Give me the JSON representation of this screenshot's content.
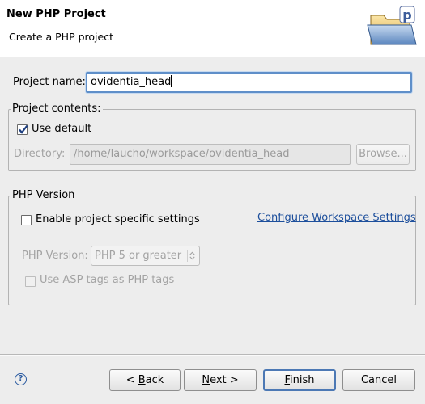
{
  "header": {
    "title": "New PHP Project",
    "description": "Create a PHP project",
    "icon": "php-project-folder-icon"
  },
  "project_name": {
    "label": "Project name:",
    "value": "ovidentia_head"
  },
  "contents": {
    "legend": "Project contents:",
    "use_default_label": "Use default",
    "use_default_checked": true,
    "directory_label": "Directory:",
    "directory_value": "/home/laucho/workspace/ovidentia_head",
    "browse_label": "Browse..."
  },
  "php_version": {
    "legend": "PHP Version",
    "enable_label": "Enable project specific settings",
    "enable_checked": false,
    "configure_link": "Configure Workspace Settings",
    "version_label": "PHP Version:",
    "version_value": "PHP 5 or greater",
    "asp_tags_label": "Use ASP tags as PHP tags",
    "asp_tags_checked": false
  },
  "footer": {
    "help_icon": "help-icon",
    "back_label": "< Back",
    "next_label": "Next >",
    "finish_label": "Finish",
    "cancel_label": "Cancel"
  },
  "colors": {
    "link": "#1d4f9c",
    "focus": "#5f8fc9",
    "default_button_border": "#4c78b4"
  }
}
